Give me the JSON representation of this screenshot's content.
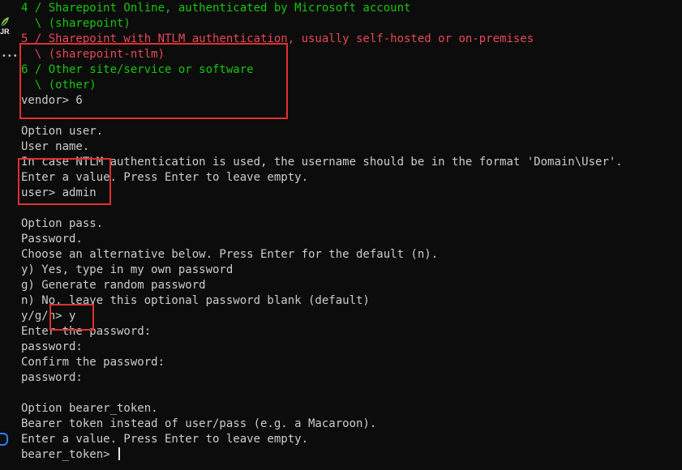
{
  "colors": {
    "background": "#0c0c0c",
    "foreground": "#cccccc",
    "green": "#16c60c",
    "red": "#e74856",
    "highlight_box": "#e03030"
  },
  "gutter": {
    "icons": [
      "leaf-icon",
      "more-dots-icon",
      "blue-bracket-icon"
    ],
    "label": "JR",
    "dots": "•••"
  },
  "terminal": {
    "lines": [
      {
        "text": "4 / Sharepoint Online, authenticated by Microsoft account",
        "color": "green"
      },
      {
        "text": "  \\ (sharepoint)",
        "color": "green"
      },
      {
        "text": "5 / Sharepoint with NTLM authentication, usually self-hosted or on-premises",
        "color": "red"
      },
      {
        "text": "  \\ (sharepoint-ntlm)",
        "color": "red"
      },
      {
        "text": "6 / Other site/service or software",
        "color": "green"
      },
      {
        "text": "  \\ (other)",
        "color": "green"
      },
      {
        "text": "vendor> 6",
        "color": "white"
      },
      {
        "text": "",
        "color": "white"
      },
      {
        "text": "Option user.",
        "color": "white"
      },
      {
        "text": "User name.",
        "color": "white"
      },
      {
        "text": "In case NTLM authentication is used, the username should be in the format 'Domain\\User'.",
        "color": "white"
      },
      {
        "text": "Enter a value. Press Enter to leave empty.",
        "color": "white"
      },
      {
        "text": "user> admin",
        "color": "white"
      },
      {
        "text": "",
        "color": "white"
      },
      {
        "text": "Option pass.",
        "color": "white"
      },
      {
        "text": "Password.",
        "color": "white"
      },
      {
        "text": "Choose an alternative below. Press Enter for the default (n).",
        "color": "white"
      },
      {
        "text": "y) Yes, type in my own password",
        "color": "white"
      },
      {
        "text": "g) Generate random password",
        "color": "white"
      },
      {
        "text": "n) No, leave this optional password blank (default)",
        "color": "white"
      },
      {
        "text": "y/g/n> y",
        "color": "white"
      },
      {
        "text": "Enter the password:",
        "color": "white"
      },
      {
        "text": "password:",
        "color": "white"
      },
      {
        "text": "Confirm the password:",
        "color": "white"
      },
      {
        "text": "password:",
        "color": "white"
      },
      {
        "text": "",
        "color": "white"
      },
      {
        "text": "Option bearer_token.",
        "color": "white"
      },
      {
        "text": "Bearer token instead of user/pass (e.g. a Macaroon).",
        "color": "white"
      },
      {
        "text": "Enter a value. Press Enter to leave empty.",
        "color": "white"
      },
      {
        "text": "bearer_token> ",
        "color": "white",
        "cursor": true
      }
    ]
  }
}
